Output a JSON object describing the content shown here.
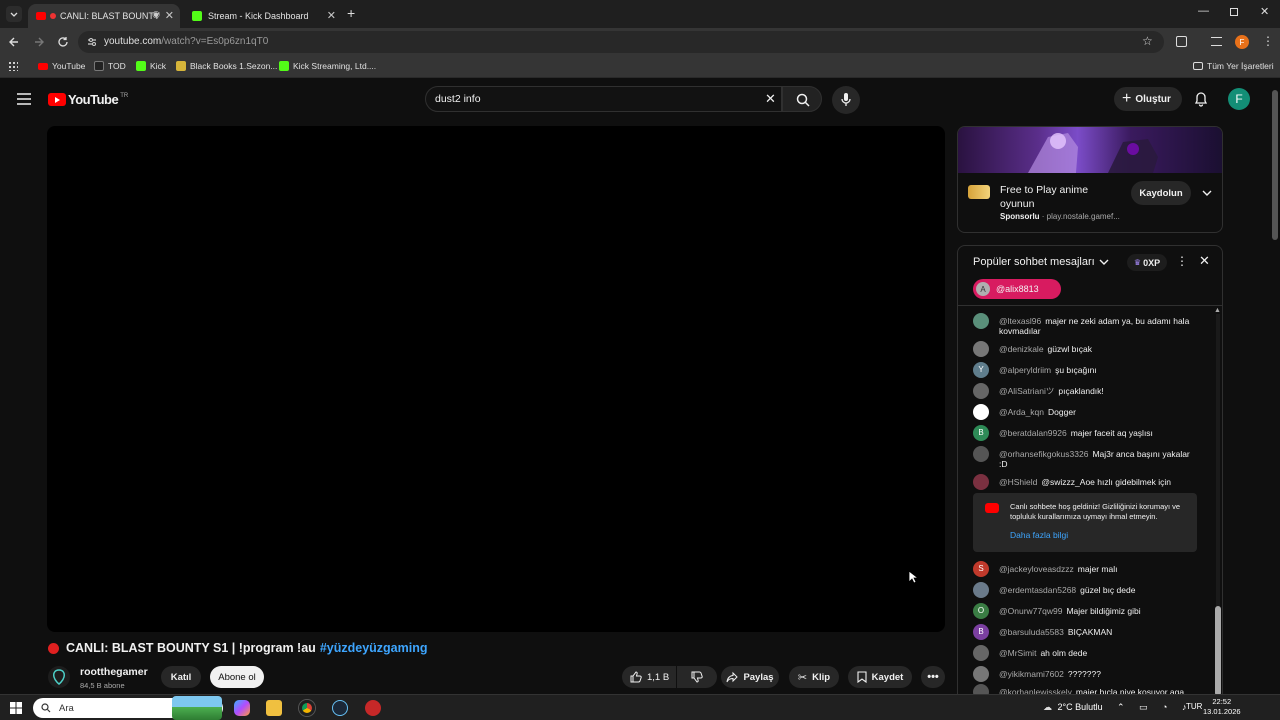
{
  "browser": {
    "tabs": [
      {
        "label": "CANLI: BLAST BOUNTY",
        "active": true
      },
      {
        "label": "Stream - Kick Dashboard",
        "active": false
      }
    ],
    "url_main": "youtube.com",
    "url_path": "/watch?v=Es0p6zn1qT0",
    "bookmarks": [
      "YouTube",
      "TOD",
      "Kick",
      "Black Books 1.Sezon...",
      "Kick Streaming, Ltd...."
    ],
    "all_bookmarks": "Tüm Yer İşaretleri",
    "profile_initial": "F"
  },
  "yt": {
    "logo": "YouTube",
    "region": "TR",
    "search_query": "dust2 info",
    "create_label": "Oluştur",
    "avatar_initial": "F"
  },
  "video": {
    "title": "CANLI: BLAST BOUNTY S1 | !program !au",
    "hashtag": "#yüzdeyüzgaming",
    "channel_name": "rootthegamer",
    "subscribers": "84,5 B abone",
    "join_label": "Katıl",
    "subscribe_label": "Abone ol",
    "likes": "1,1 B",
    "share_label": "Paylaş",
    "clip_label": "Klip",
    "save_label": "Kaydet"
  },
  "ad": {
    "title": "Free to Play anime oyunun",
    "sponsor": "Sponsorlu",
    "domain": "play.nostale.gamef...",
    "cta": "Kaydolun"
  },
  "chat": {
    "title": "Popüler sohbet mesajları",
    "xp": "0XP",
    "pinned_user": "@alix8813",
    "pinned_initial": "A",
    "messages": [
      {
        "author": "@ltexasl96",
        "text": "majer ne zeki adam ya, bu adamı hala kovmadılar",
        "initial": "",
        "color": "#5a8f7a"
      },
      {
        "author": "@denizkale",
        "text": "güzwl bıçak",
        "initial": "",
        "color": "#777"
      },
      {
        "author": "@alperyldriim",
        "text": "şu bıçağını",
        "initial": "Y",
        "color": "#5f7d8c"
      },
      {
        "author": "@AliSatrianiツ",
        "text": "pıçaklandık!",
        "initial": "",
        "color": "#666"
      },
      {
        "author": "@Arda_kqn",
        "text": "Dogger",
        "initial": "",
        "color": "#ffffff"
      },
      {
        "author": "@beratdalan9926",
        "text": "majer faceit aq yaşlısı",
        "initial": "B",
        "color": "#2e8b57"
      },
      {
        "author": "@orhansefikgokus3326",
        "text": "Maj3r anca başını yakalar :D",
        "initial": "",
        "color": "#555"
      },
      {
        "author": "@HShield",
        "text": "@swizzz_Aoe hızlı gidebilmek için",
        "initial": "",
        "color": "#7a3040"
      },
      {
        "author": "@jackeyloveasdzzz",
        "text": "majer malı",
        "initial": "S",
        "color": "#c0392b"
      },
      {
        "author": "@erdemtasdan5268",
        "text": "güzel bıç dede",
        "initial": "",
        "color": "#6a7a8a"
      },
      {
        "author": "@Onurw77qw99",
        "text": "Majer bildiğimiz gibi",
        "initial": "O",
        "color": "#3a7d44"
      },
      {
        "author": "@barsuluda5583",
        "text": "BIÇAKMAN",
        "initial": "B",
        "color": "#7b3fa0"
      },
      {
        "author": "@MrSimit",
        "text": "ah olm dede",
        "initial": "",
        "color": "#666"
      },
      {
        "author": "@yikikmami7602",
        "text": "???????",
        "initial": "",
        "color": "#777"
      },
      {
        "author": "@korhanlewisskely",
        "text": "majer bıçla niye kosuyor aga",
        "initial": "",
        "color": "#555"
      }
    ],
    "notice_text": "Canlı sohbete hoş geldiniz! Gizliliğinizi korumayı ve topluluk kurallarımıza uymayı ihmal etmeyin.",
    "notice_link": "Daha fazla bilgi"
  },
  "taskbar": {
    "search_label": "Ara",
    "weather": "2°C Bulutlu",
    "lang": "TUR",
    "time": "22:52",
    "date": "13.01.2026"
  }
}
